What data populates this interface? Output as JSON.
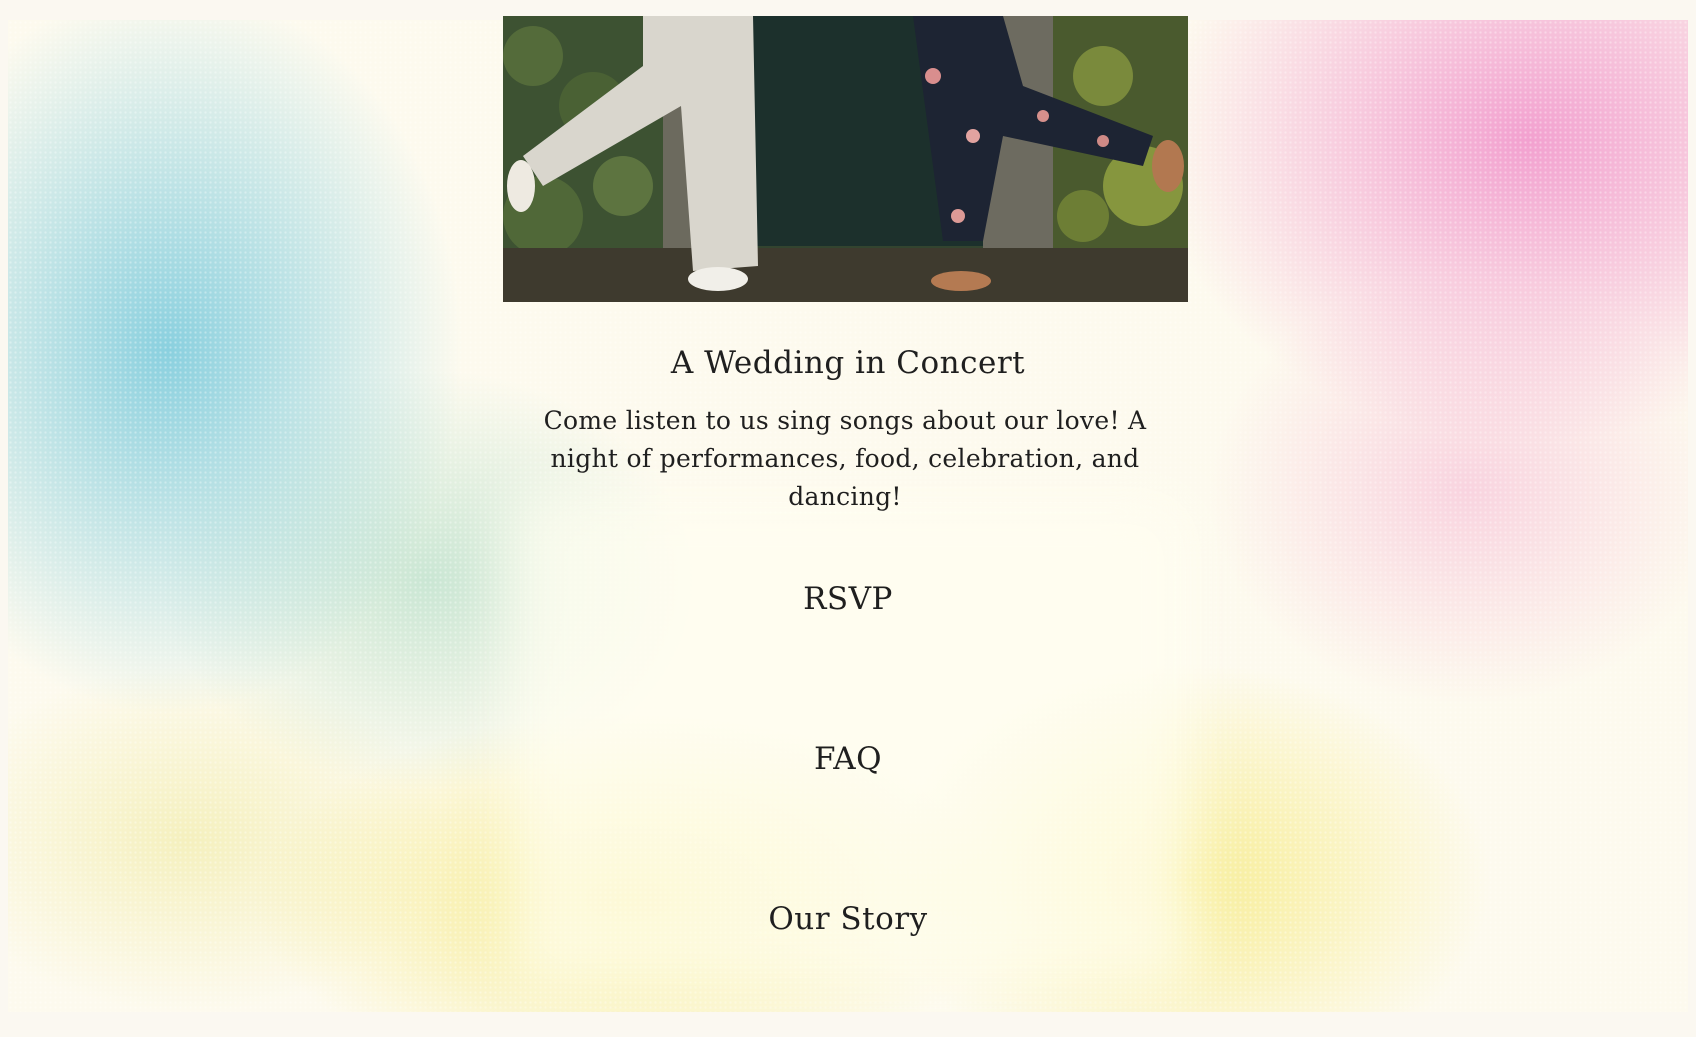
{
  "hero": {
    "title": "A Wedding in Concert",
    "description": "Come listen to us sing songs about our love! A night of performances, food, celebration, and dancing!"
  },
  "nav": {
    "rsvp": "RSVP",
    "faq": "FAQ",
    "our_story": "Our Story"
  },
  "colors": {
    "text": "#1f1f1f",
    "gradient_blue": "#84cede",
    "gradient_pink": "#f29cce",
    "gradient_yellow": "#f4e878",
    "page_background": "#fbf8f1"
  }
}
